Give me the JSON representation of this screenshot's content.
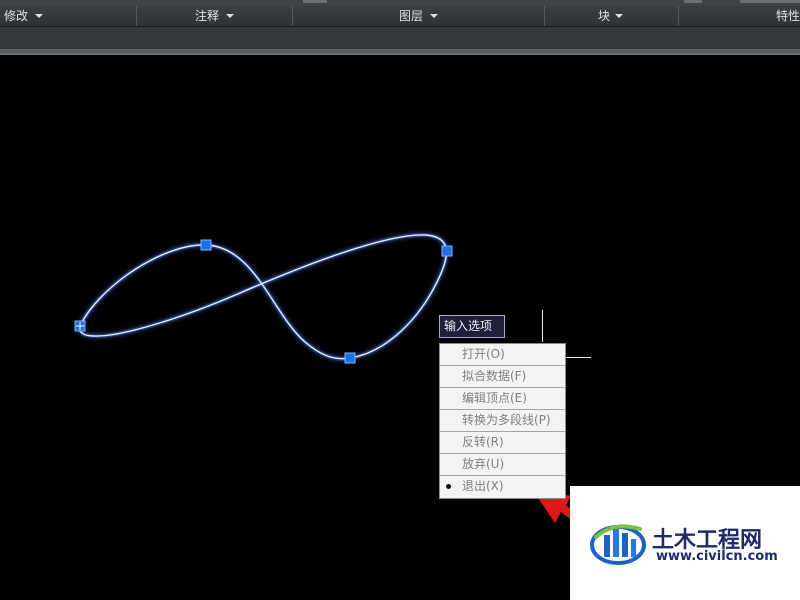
{
  "ribbon": {
    "panels": [
      {
        "label": "修改"
      },
      {
        "label": "注释"
      },
      {
        "label": "图层"
      },
      {
        "label": "块"
      },
      {
        "label": "特性"
      }
    ]
  },
  "command": {
    "prompt": "输入选项",
    "options": [
      {
        "label": "打开(O)",
        "selected": false
      },
      {
        "label": "拟合数据(F)",
        "selected": false
      },
      {
        "label": "编辑顶点(E)",
        "selected": false
      },
      {
        "label": "转换为多段线(P)",
        "selected": false
      },
      {
        "label": "反转(R)",
        "selected": false
      },
      {
        "label": "放弃(U)",
        "selected": false
      },
      {
        "label": "退出(X)",
        "selected": true
      }
    ]
  },
  "watermark": {
    "title": "土木工程网",
    "url": "www.civilcn.com"
  },
  "colors": {
    "canvas": "#000000",
    "spline": "#dbe8ff",
    "spline_glow": "#3f6fd6",
    "grip": "#1a73e6",
    "arrow": "#e21818",
    "brand": "#1d2b6b"
  },
  "icons": {
    "grip": "grip-square-icon",
    "caret": "chevron-down-icon",
    "bullet": "bullet-dot-icon",
    "pointer": "red-arrow-icon"
  }
}
